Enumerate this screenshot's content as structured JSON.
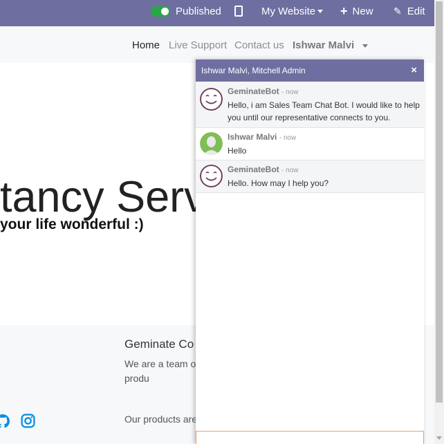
{
  "topbar": {
    "published_label": "Published",
    "website_label": "My Website",
    "new_label": "New",
    "edit_label": "Edit"
  },
  "navbar": {
    "links": [
      {
        "label": "Home"
      },
      {
        "label": "Live Support"
      },
      {
        "label": "Contact us"
      }
    ],
    "user_label": "Ishwar Malvi"
  },
  "hero": {
    "title": "ltancy Serv",
    "subtitle": "your life wonderful :)"
  },
  "about": {
    "heading": "Geminate Co",
    "paragraph1": "We are a team o improve everyon build great produ",
    "paragraph2": "Our products are companies willin"
  },
  "social": {
    "icons": [
      "github-icon",
      "instagram-icon"
    ],
    "color": "#0d8fe0"
  },
  "chat": {
    "title": "Ishwar Malvi, Mitchell Admin",
    "close_glyph": "×",
    "messages": [
      {
        "author": "GeminateBot",
        "time": "- now",
        "text": "Hello, i am Sales Team Chat Bot. I would like to help you until our representative connects to you."
      },
      {
        "author": "Ishwar Malvi",
        "time": "- now",
        "text": "Hello"
      },
      {
        "author": "GeminateBot",
        "time": "- now",
        "text": "Hello. How may I help you?"
      }
    ],
    "composer_value": ""
  },
  "colors": {
    "topbar_bg": "#6f6ea0",
    "toggle_on": "#28a745",
    "navbar_bg": "#f7f8fa"
  }
}
